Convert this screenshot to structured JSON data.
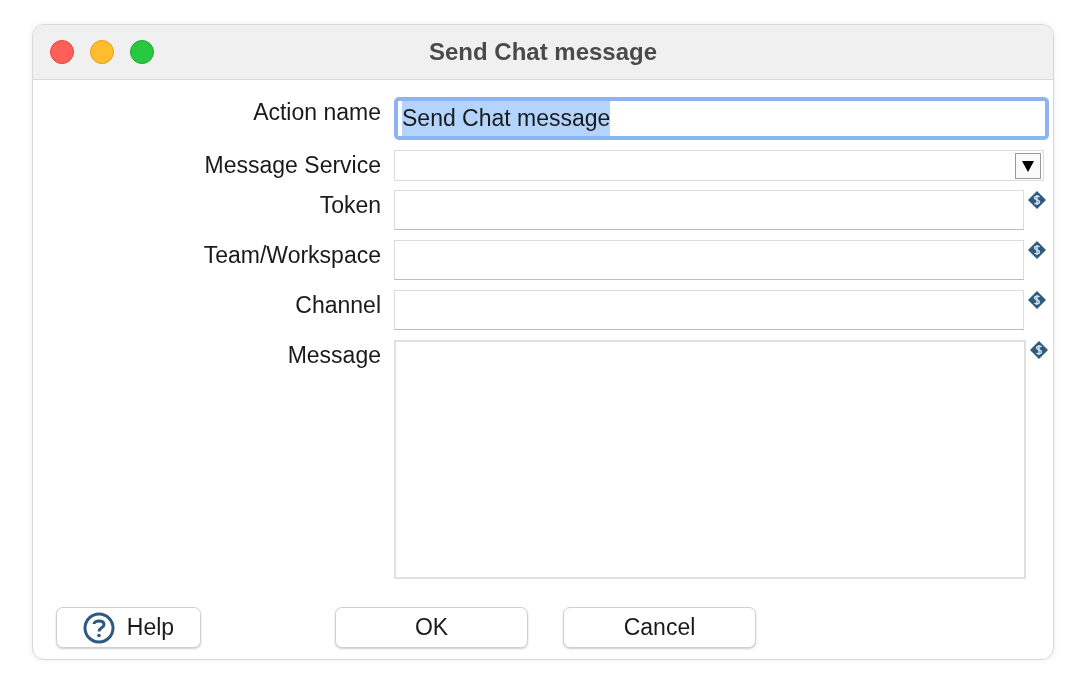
{
  "window": {
    "title": "Send Chat message"
  },
  "fields": [
    {
      "label": "Action name",
      "kind": "text",
      "value": "Send Chat message",
      "focused": true,
      "variable": false
    },
    {
      "label": "Message Service",
      "kind": "dropdown",
      "focused": false,
      "variable": false
    },
    {
      "label": "Token",
      "kind": "text",
      "focused": false,
      "variable": true
    },
    {
      "label": "Team/Workspace",
      "kind": "text",
      "focused": false,
      "variable": true
    },
    {
      "label": "Channel",
      "kind": "text",
      "focused": false,
      "variable": true
    },
    {
      "label": "Message",
      "kind": "textarea",
      "focused": false,
      "variable": true
    }
  ],
  "buttons": [
    {
      "label": "Help",
      "kind": "help"
    },
    {
      "label": "OK",
      "kind": "plain"
    },
    {
      "label": "Cancel",
      "kind": "plain"
    }
  ]
}
